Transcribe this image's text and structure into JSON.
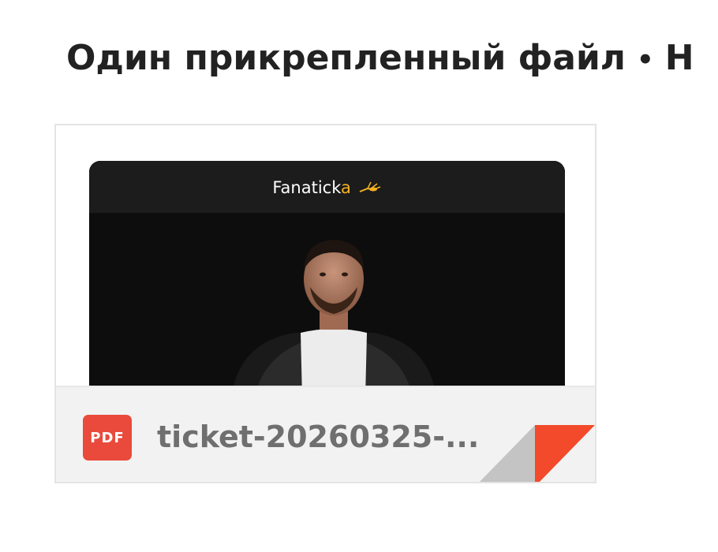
{
  "header": {
    "title": "Один прикрепленный файл",
    "separator": "•",
    "trailing": "Н"
  },
  "attachment": {
    "preview": {
      "brand_main": "Fanatick",
      "brand_accent": "a",
      "brand_accent_color": "#f5b21e"
    },
    "file_type_label": "PDF",
    "file_type_color": "#e94a3c",
    "filename": "ticket-20260325-..."
  }
}
